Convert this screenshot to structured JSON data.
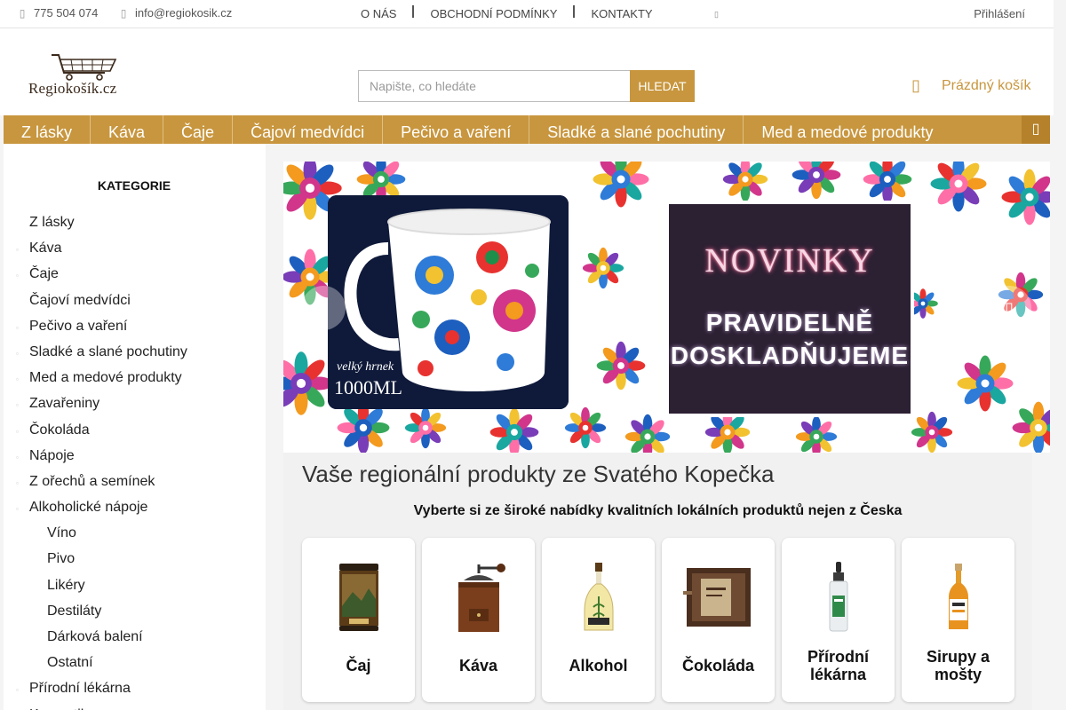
{
  "topbar": {
    "phone": "775 504 074",
    "email": "info@regiokosik.cz",
    "links": [
      "O NÁS",
      "OBCHODNÍ PODMÍNKY",
      "KONTAKTY"
    ],
    "login": "Přihlášení"
  },
  "header": {
    "logo_text": "Regiokošík.cz",
    "search_placeholder": "Napište, co hledáte",
    "search_button": "HLEDAT",
    "cart_label": "Prázdný košík"
  },
  "nav": {
    "items": [
      "Z lásky",
      "Káva",
      "Čaje",
      "Čajoví medvídci",
      "Pečivo a vaření",
      "Sladké a slané pochutiny",
      "Med a medové produkty"
    ]
  },
  "sidebar": {
    "title": "KATEGORIE",
    "items": [
      {
        "label": "Z lásky",
        "level": 0,
        "bullet": false
      },
      {
        "label": "Káva",
        "level": 0,
        "bullet": true
      },
      {
        "label": "Čaje",
        "level": 0,
        "bullet": true
      },
      {
        "label": "Čajoví medvídci",
        "level": 0,
        "bullet": false
      },
      {
        "label": "Pečivo a vaření",
        "level": 0,
        "bullet": true
      },
      {
        "label": "Sladké a slané pochutiny",
        "level": 0,
        "bullet": true
      },
      {
        "label": "Med a medové produkty",
        "level": 0,
        "bullet": true
      },
      {
        "label": "Zavařeniny",
        "level": 0,
        "bullet": true
      },
      {
        "label": "Čokoláda",
        "level": 0,
        "bullet": true
      },
      {
        "label": "Nápoje",
        "level": 0,
        "bullet": true
      },
      {
        "label": "Z ořechů a semínek",
        "level": 0,
        "bullet": true
      },
      {
        "label": "Alkoholické nápoje",
        "level": 0,
        "bullet": true
      },
      {
        "label": "Víno",
        "level": 1,
        "bullet": false
      },
      {
        "label": "Pivo",
        "level": 1,
        "bullet": false
      },
      {
        "label": "Likéry",
        "level": 1,
        "bullet": false
      },
      {
        "label": "Destiláty",
        "level": 1,
        "bullet": false
      },
      {
        "label": "Dárková balení",
        "level": 1,
        "bullet": false
      },
      {
        "label": "Ostatní",
        "level": 1,
        "bullet": false
      },
      {
        "label": "Přírodní lékárna",
        "level": 0,
        "bullet": true
      },
      {
        "label": "Kosmetika",
        "level": 0,
        "bullet": true
      }
    ]
  },
  "banner": {
    "mug_caption1": "velký hrnek",
    "mug_caption2": "1000ML",
    "news_title": "NOVINKY",
    "news_sub1": "PRAVIDELNĚ",
    "news_sub2": "DOSKLADŇUJEME"
  },
  "main": {
    "headline": "Vaše regionální produkty ze Svatého Kopečka",
    "subline": "Vyberte si ze široké nabídky kvalitních lokálních produktů nejen z Česka",
    "tiles": [
      {
        "label": "Čaj"
      },
      {
        "label": "Káva"
      },
      {
        "label": "Alkohol"
      },
      {
        "label": "Čokoláda"
      },
      {
        "label": "Přírodní lékárna"
      },
      {
        "label": "Sirupy a mošty"
      }
    ]
  },
  "colors": {
    "accent": "#c8963e",
    "accent_dark": "#b5822b",
    "page_bg": "#f4f4f4"
  }
}
